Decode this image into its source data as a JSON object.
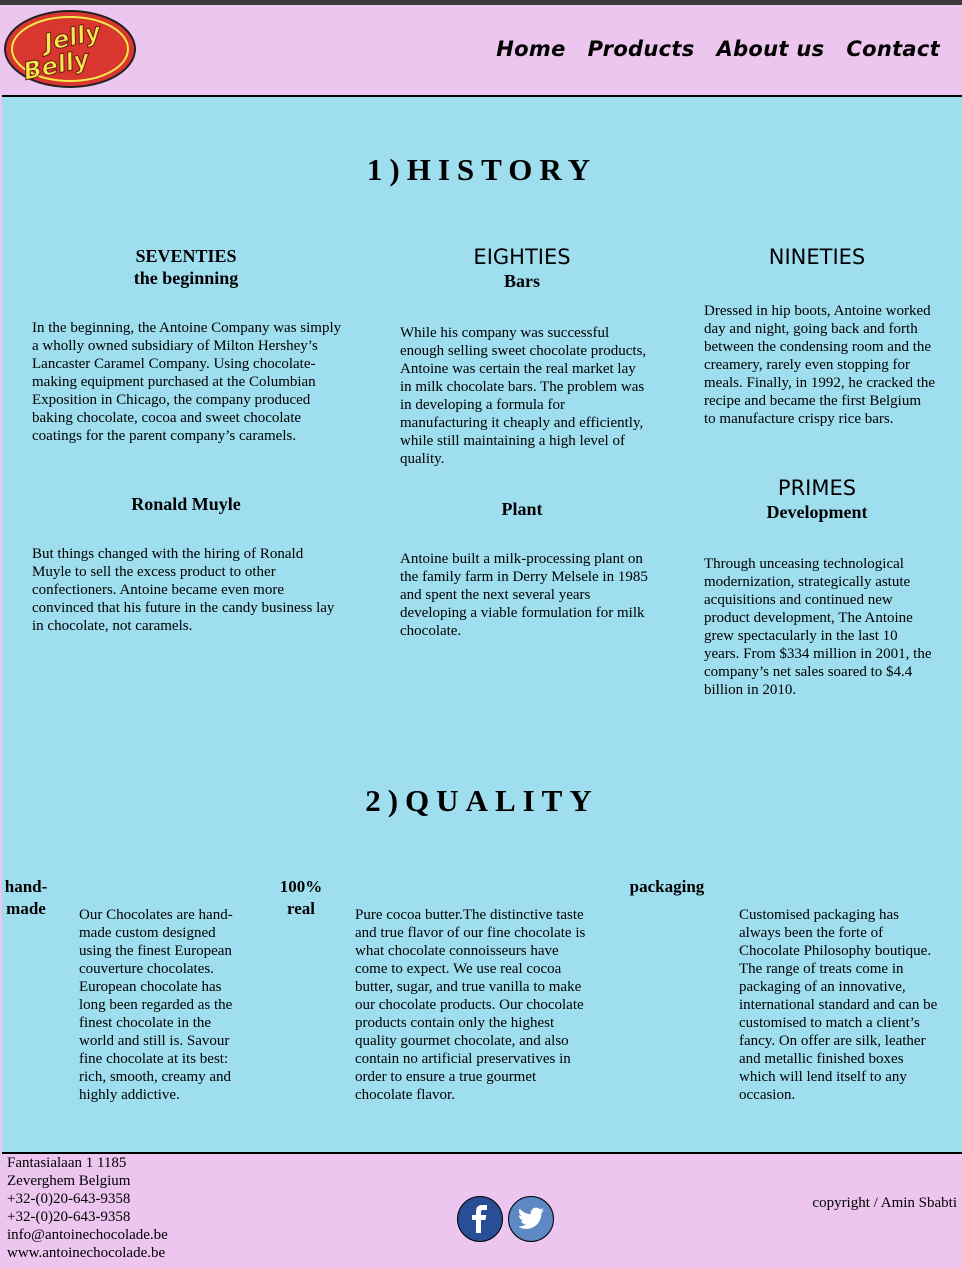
{
  "brand": {
    "logo_text_line1": "Jelly",
    "logo_text_line2": "Belly"
  },
  "nav": [
    {
      "label": "Home"
    },
    {
      "label": "Products"
    },
    {
      "label": "About us"
    },
    {
      "label": "Contact"
    }
  ],
  "history": {
    "title": "1)HISTORY",
    "seventies": {
      "heading": "SEVENTIES",
      "subheading": "the beginning",
      "text": "In the beginning, the Antoine Company was simply a wholly owned subsidiary of Milton Hershey’s Lancaster Caramel Company. Using chocolate-making equipment purchased at the Columbian Exposition in Chicago, the company produced baking chocolate, cocoa and sweet chocolate coatings for the parent company’s caramels.",
      "sub2": "Ronald Muyle",
      "text2": "But things changed with the hiring of Ronald Muyle to sell the excess product to other confectioners. Antoine became even more convinced that his future in the candy business lay in chocolate, not caramels."
    },
    "eighties": {
      "heading": "EIGHTIES",
      "subheading": "Bars",
      "text": "While his company was successful enough selling sweet chocolate products, Antoine was certain the real market lay in milk chocolate bars. The problem was in developing a formula for manufacturing it cheaply and efficiently, while still maintaining a high level of quality.",
      "sub2": "Plant",
      "text2": "Antoine built a milk-processing plant on the family farm in Derry Melsele in 1985 and spent the next several years developing a viable formulation for milk chocolate."
    },
    "nineties": {
      "heading": "NINETIES",
      "text": "Dressed in hip boots, Antoine worked day and night, going back and forth between the condensing room and the creamery, rarely even stopping for meals. Finally, in 1992, he cracked the recipe and became the first Belgium to manufacture crispy rice bars.",
      "heading2": "PRIMES",
      "sub2": "Development",
      "text2": "Through unceasing technological modernization, strategically astute acquisitions and continued new product development, The Antoine grew spectacularly in the last 10 years. From $334 million in 2001, the company’s net sales soared to $4.4 billion in 2010."
    }
  },
  "quality": {
    "title": "2)QUALITY",
    "handmade": {
      "heading": "hand-made",
      "text": "Our Chocolates are hand-made custom designed using the finest European couverture chocolates. European chocolate has long been regarded as the finest chocolate in the world and still is. Savour fine chocolate at its best: rich, smooth, creamy and highly addictive."
    },
    "real": {
      "heading": "100% real",
      "text": "Pure cocoa butter.The distinctive taste and true flavor of our fine chocolate is what chocolate connoisseurs have come to expect. We use real cocoa butter, sugar, and true vanilla to make our chocolate products. Our chocolate products contain only the highest quality gourmet chocolate, and also contain no artificial preservatives in order to ensure a true gourmet chocolate flavor."
    },
    "packaging": {
      "heading": "packaging",
      "text": "Customised packaging has always been the forte of Chocolate Philosophy boutique. The range of treats come in packaging of an innovative, international standard and can be customised to match a client’s fancy. On offer are silk, leather and metallic finished boxes which will lend itself to any occasion."
    }
  },
  "footer": {
    "address_lines": [
      "Fantasialaan 1 1185",
      "Zeverghem Belgium",
      "+32-(0)20-643-9358",
      "+32-(0)20-643-9358",
      "info@antoinechocolade.be",
      "www.antoinechocolade.be"
    ],
    "copyright": "copyright / Amin Sbabti",
    "social": [
      {
        "icon": "facebook-icon"
      },
      {
        "icon": "twitter-icon"
      }
    ]
  },
  "colors": {
    "header_bg": "#ecc6ee",
    "main_bg": "#9fdeee",
    "logo_red": "#d8362f",
    "logo_yellow": "#f6e84a",
    "facebook": "#2a4e95",
    "twitter": "#5d88c3"
  }
}
